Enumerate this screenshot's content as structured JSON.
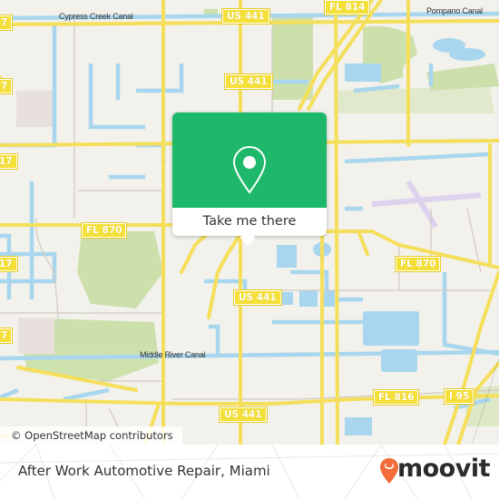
{
  "map": {
    "labels": {
      "cypress_creek_canal": "Cypress Creek Canal",
      "pompano_canal": "Pompano Canal",
      "middle_river_canal": "Middle River Canal"
    },
    "shields": {
      "us441_top": "US 441",
      "fl814": "FL 814",
      "us441_upper": "US 441",
      "fl870_left": "FL 870",
      "fl870_right": "FL 870",
      "us441_mid": "US 441",
      "fl816": "FL 816",
      "us441_bottom": "US 441",
      "i95": "I 95",
      "left7_a": "7",
      "left7_b": "7",
      "left17_a": "17",
      "left17_b": "17",
      "left7_c": "7"
    },
    "attribution": "© OpenStreetMap contributors"
  },
  "popup": {
    "icon": "location-pin-icon",
    "button_label": "Take me there",
    "color": "#1db86a"
  },
  "footer": {
    "place_name": "After Work Automotive Repair, Miami",
    "logo_text": "moovit",
    "logo_color": "#f26b3a"
  }
}
